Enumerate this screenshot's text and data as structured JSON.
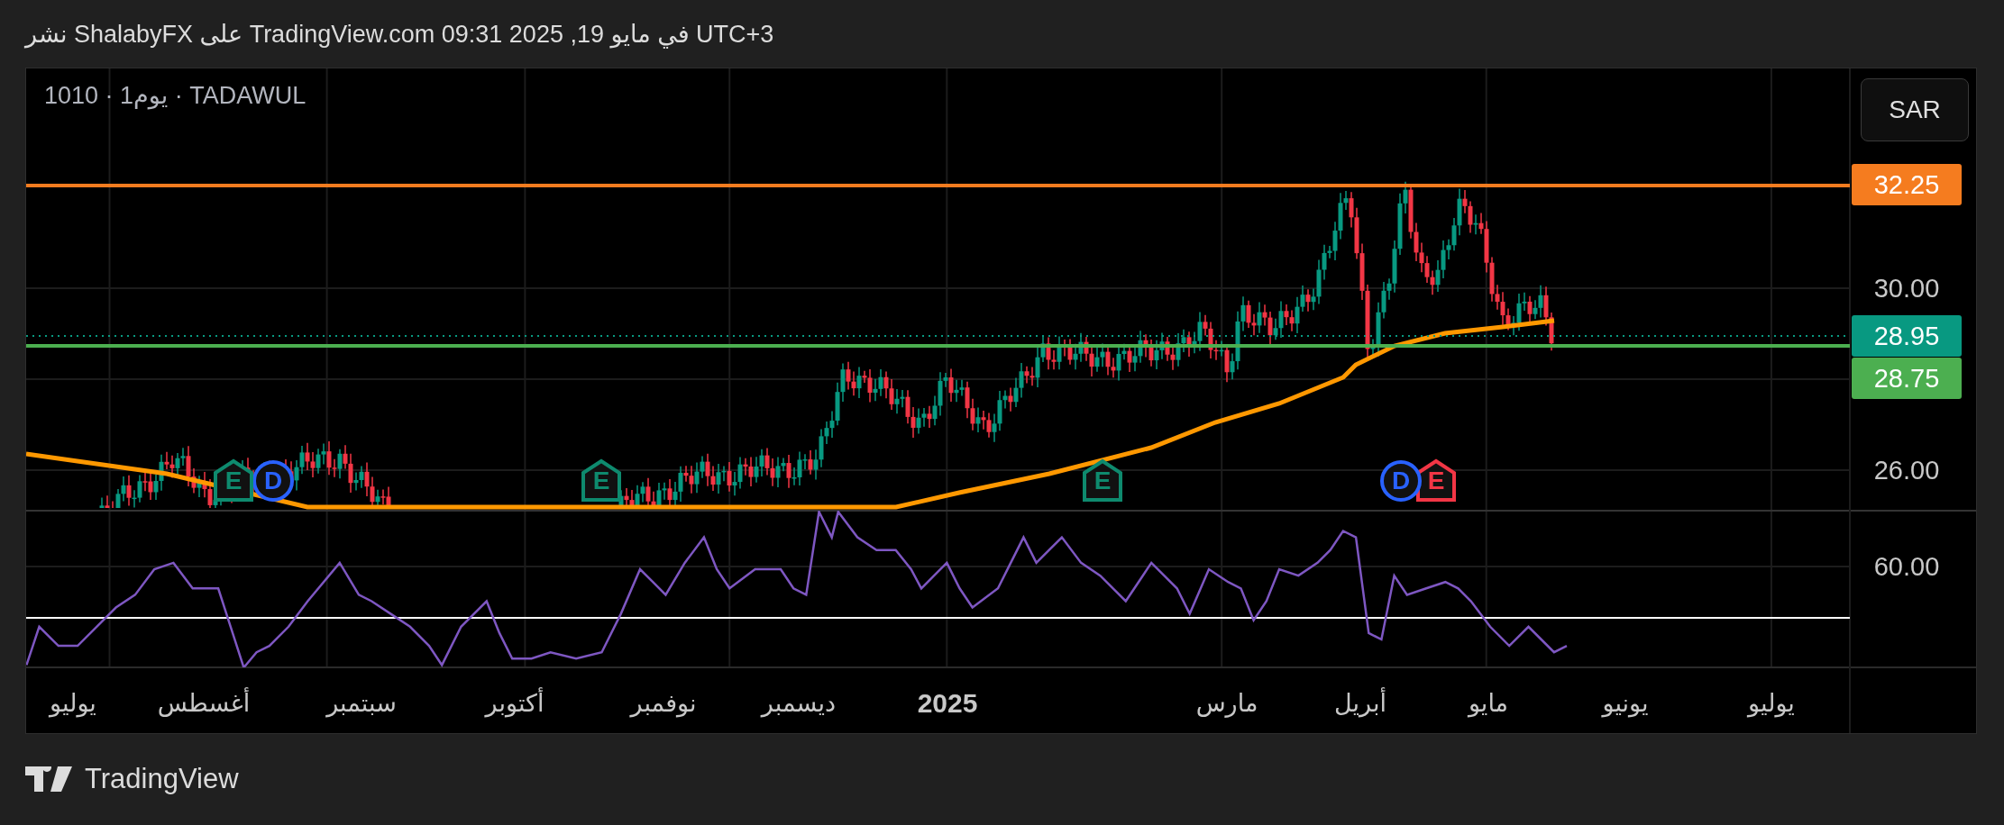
{
  "header": {
    "text": "نشر ShalabyFX على TradingView.com في مايو 19, 2025 09:31 UTC+3"
  },
  "chart": {
    "symbol_line": "1010 · 1يوم · TADAWUL",
    "currency_button": "SAR",
    "price_axis": [
      "30.00",
      "26.00"
    ],
    "price_labels": [
      {
        "text": "32.25",
        "kind": "horizontal_line",
        "color": "#f57c1f"
      },
      {
        "text": "28.95",
        "kind": "last_price",
        "color": "#089981"
      },
      {
        "text": "28.75",
        "kind": "horizontal_line",
        "color": "#4caf50"
      }
    ],
    "markers": [
      {
        "label": "E",
        "kind": "earnings",
        "color": "#f23645"
      },
      {
        "label": "D",
        "kind": "dividend",
        "color": "#2962ff"
      },
      {
        "label": "E",
        "kind": "earnings",
        "color": "#0e8a6e"
      },
      {
        "label": "E",
        "kind": "earnings",
        "color": "#0e8a6e"
      },
      {
        "label": "D",
        "kind": "dividend",
        "color": "#2962ff"
      },
      {
        "label": "E",
        "kind": "earnings",
        "color": "#0e8a6e"
      }
    ],
    "rsi_axis": [
      "60.00"
    ],
    "time_axis": [
      {
        "label": "يوليو",
        "kind": "month"
      },
      {
        "label": "يونيو",
        "kind": "month"
      },
      {
        "label": "مايو",
        "kind": "month"
      },
      {
        "label": "أبريل",
        "kind": "month"
      },
      {
        "label": "مارس",
        "kind": "month"
      },
      {
        "label": "2025",
        "kind": "year"
      },
      {
        "label": "ديسمبر",
        "kind": "month"
      },
      {
        "label": "نوفمبر",
        "kind": "month"
      },
      {
        "label": "أكتوبر",
        "kind": "month"
      },
      {
        "label": "سبتمبر",
        "kind": "month"
      },
      {
        "label": "أغسطس",
        "kind": "month"
      },
      {
        "label": "يوليو",
        "kind": "month"
      }
    ]
  },
  "footer": {
    "brand": "TradingView"
  }
}
